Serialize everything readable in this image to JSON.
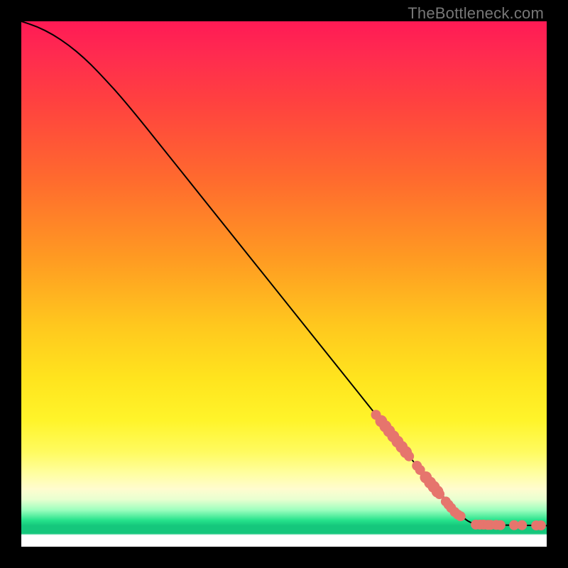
{
  "watermark": "TheBottleneck.com",
  "colors": {
    "background": "#000000",
    "curve": "#000000",
    "marker_fill": "#e6756d",
    "marker_stroke": "#c85a54",
    "gradient_top": "#ff1a55",
    "gradient_mid": "#ffe41e",
    "gradient_green": "#15c77c"
  },
  "chart_data": {
    "type": "line",
    "title": "",
    "xlabel": "",
    "ylabel": "",
    "xlim": [
      0,
      100
    ],
    "ylim": [
      0,
      100
    ],
    "curve": [
      {
        "x": 0,
        "y": 100
      },
      {
        "x": 3,
        "y": 99.0
      },
      {
        "x": 6,
        "y": 97.5
      },
      {
        "x": 9,
        "y": 95.5
      },
      {
        "x": 12,
        "y": 93.0
      },
      {
        "x": 15,
        "y": 90.0
      },
      {
        "x": 20,
        "y": 84.5
      },
      {
        "x": 30,
        "y": 72.0
      },
      {
        "x": 40,
        "y": 59.5
      },
      {
        "x": 50,
        "y": 47.0
      },
      {
        "x": 60,
        "y": 34.5
      },
      {
        "x": 70,
        "y": 22.0
      },
      {
        "x": 78,
        "y": 12.0
      },
      {
        "x": 84,
        "y": 5.5
      },
      {
        "x": 86,
        "y": 4.3
      },
      {
        "x": 88,
        "y": 4.2
      },
      {
        "x": 90,
        "y": 4.15
      },
      {
        "x": 92,
        "y": 4.1
      },
      {
        "x": 94,
        "y": 4.1
      },
      {
        "x": 96,
        "y": 4.05
      },
      {
        "x": 98,
        "y": 4.05
      },
      {
        "x": 100,
        "y": 4.0
      }
    ],
    "markers_diagonal": [
      {
        "x": 67.5,
        "y": 25.1,
        "r": 1.0
      },
      {
        "x": 68.5,
        "y": 23.9,
        "r": 1.2
      },
      {
        "x": 69.3,
        "y": 22.9,
        "r": 1.2
      },
      {
        "x": 70.0,
        "y": 22.0,
        "r": 1.2
      },
      {
        "x": 70.8,
        "y": 21.0,
        "r": 1.2
      },
      {
        "x": 71.6,
        "y": 20.0,
        "r": 1.2
      },
      {
        "x": 72.4,
        "y": 19.0,
        "r": 1.2
      },
      {
        "x": 73.2,
        "y": 18.0,
        "r": 1.2
      },
      {
        "x": 73.8,
        "y": 17.2,
        "r": 1.0
      },
      {
        "x": 75.3,
        "y": 15.4,
        "r": 1.0
      },
      {
        "x": 75.9,
        "y": 14.6,
        "r": 1.0
      },
      {
        "x": 77.0,
        "y": 13.2,
        "r": 1.2
      },
      {
        "x": 77.8,
        "y": 12.2,
        "r": 1.2
      },
      {
        "x": 78.5,
        "y": 11.4,
        "r": 1.2
      },
      {
        "x": 79.2,
        "y": 10.5,
        "r": 1.2
      },
      {
        "x": 79.6,
        "y": 10.0,
        "r": 1.0
      },
      {
        "x": 80.8,
        "y": 8.6,
        "r": 1.0
      },
      {
        "x": 81.3,
        "y": 8.0,
        "r": 1.0
      },
      {
        "x": 81.8,
        "y": 7.4,
        "r": 1.0
      },
      {
        "x": 82.5,
        "y": 6.6,
        "r": 1.0
      },
      {
        "x": 83.1,
        "y": 6.1,
        "r": 1.0
      },
      {
        "x": 83.6,
        "y": 5.8,
        "r": 1.0
      }
    ],
    "markers_flat": [
      {
        "x": 86.5,
        "y": 4.2,
        "r": 1.0
      },
      {
        "x": 87.3,
        "y": 4.2,
        "r": 1.0
      },
      {
        "x": 88.0,
        "y": 4.2,
        "r": 1.0
      },
      {
        "x": 88.8,
        "y": 4.15,
        "r": 1.0
      },
      {
        "x": 89.3,
        "y": 4.15,
        "r": 1.0
      },
      {
        "x": 90.4,
        "y": 4.15,
        "r": 1.0
      },
      {
        "x": 91.2,
        "y": 4.1,
        "r": 1.0
      },
      {
        "x": 93.8,
        "y": 4.1,
        "r": 1.0
      },
      {
        "x": 95.3,
        "y": 4.1,
        "r": 1.0
      },
      {
        "x": 98.0,
        "y": 4.05,
        "r": 1.0
      },
      {
        "x": 98.9,
        "y": 4.05,
        "r": 1.0
      }
    ]
  }
}
